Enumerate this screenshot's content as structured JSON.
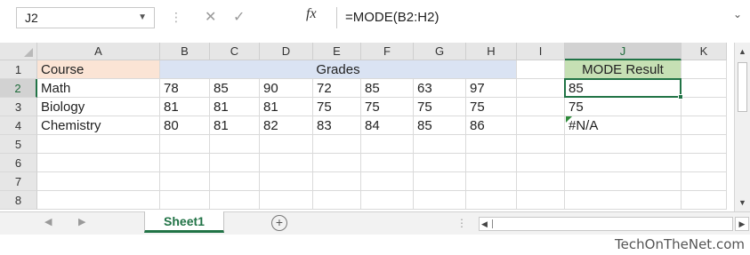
{
  "formula_bar": {
    "name_box": "J2",
    "name_box_dropdown_icon": "chevron-down-icon",
    "cancel_icon": "✕",
    "enter_icon": "✓",
    "fx_label": "fx",
    "formula": "=MODE(B2:H2)",
    "expand_icon": "chevron-down-icon"
  },
  "columns": [
    "A",
    "B",
    "C",
    "D",
    "E",
    "F",
    "G",
    "H",
    "I",
    "J",
    "K"
  ],
  "rows": [
    "1",
    "2",
    "3",
    "4",
    "5",
    "6",
    "7",
    "8"
  ],
  "selected_cell": "J2",
  "cells": {
    "A1": "Course",
    "B1": "Grades",
    "J1": "MODE Result",
    "A2": "Math",
    "B2": "78",
    "C2": "85",
    "D2": "90",
    "E2": "72",
    "F2": "85",
    "G2": "63",
    "H2": "97",
    "J2": "85",
    "A3": "Biology",
    "B3": "81",
    "C3": "81",
    "D3": "81",
    "E3": "75",
    "F3": "75",
    "G3": "75",
    "H3": "75",
    "J3": "75",
    "A4": "Chemistry",
    "B4": "80",
    "C4": "81",
    "D4": "82",
    "E4": "83",
    "F4": "84",
    "G4": "85",
    "H4": "86",
    "J4": "#N/A"
  },
  "colors": {
    "course_fill": "#fbe4d5",
    "grades_fill": "#dae3f3",
    "mode_fill": "#c6e0b4",
    "accent": "#217346"
  },
  "sheet_tabs": {
    "active_tab": "Sheet1",
    "add_sheet_label": "+"
  },
  "watermark": "TechOnTheNet.com"
}
